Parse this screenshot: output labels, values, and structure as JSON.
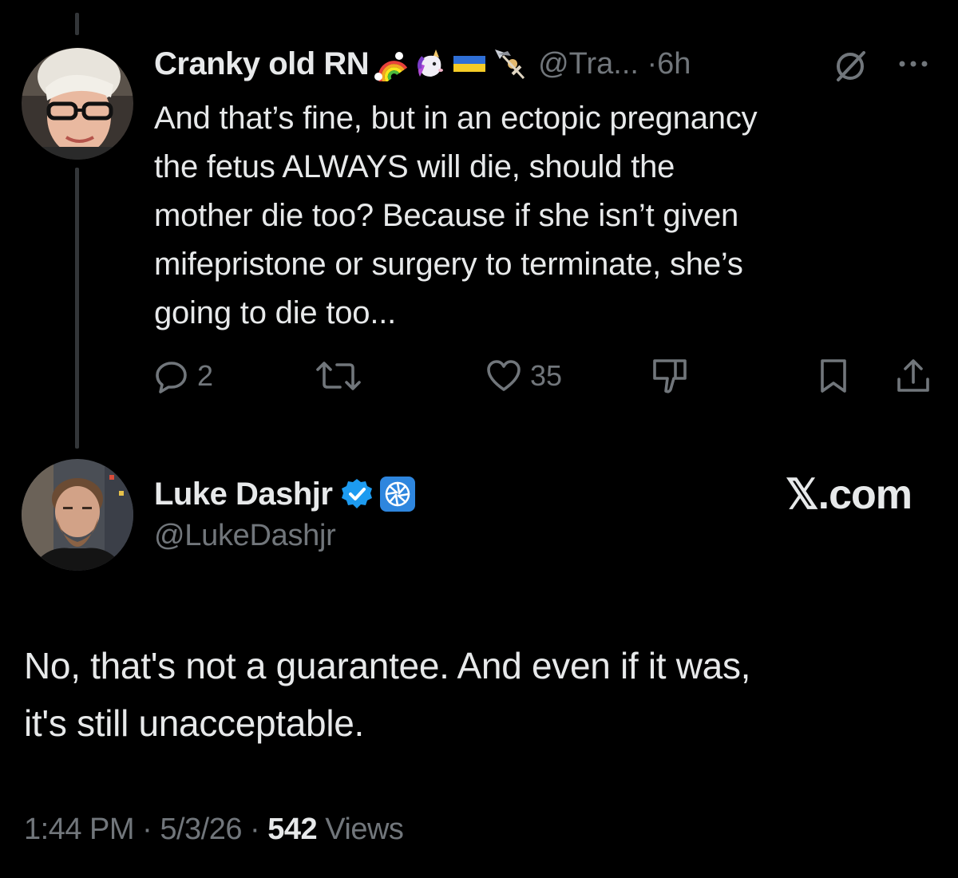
{
  "parent_tweet": {
    "display_name": "Cranky old RN",
    "emojis": [
      "rainbow-emoji",
      "unicorn-emoji",
      "ukraine-flag-emoji",
      "syringe-emoji"
    ],
    "handle": "@Tra...",
    "separator": "·",
    "time": "6h",
    "text_lines": [
      "And that’s fine, but in an ectopic pregnancy",
      "the fetus ALWAYS will die, should the",
      "mother die too? Because if she isn’t given",
      "mifepristone or surgery to terminate, she’s",
      "going to die too..."
    ],
    "actions": {
      "reply_count": "2",
      "repost_count": "",
      "like_count": "35"
    }
  },
  "main_tweet": {
    "display_name": "Luke Dashjr",
    "handle": "@LukeDashjr",
    "badge_icons": [
      "verified-checkmark-icon",
      "affiliate-logo-icon"
    ],
    "watermark": "𝕏.com",
    "text_lines": [
      "No, that's not a guarantee. And even if it was,",
      "it's still unacceptable."
    ],
    "meta": {
      "time": "1:44 PM",
      "separator1": " · ",
      "date": "5/3/26",
      "separator2": " · ",
      "views_count": "542",
      "views_label": " Views"
    }
  },
  "colors": {
    "background": "#000000",
    "primary_text": "#e7e9ea",
    "secondary_text": "#71767b",
    "thread_line": "#333639",
    "verified_blue": "#1d9bf0"
  }
}
